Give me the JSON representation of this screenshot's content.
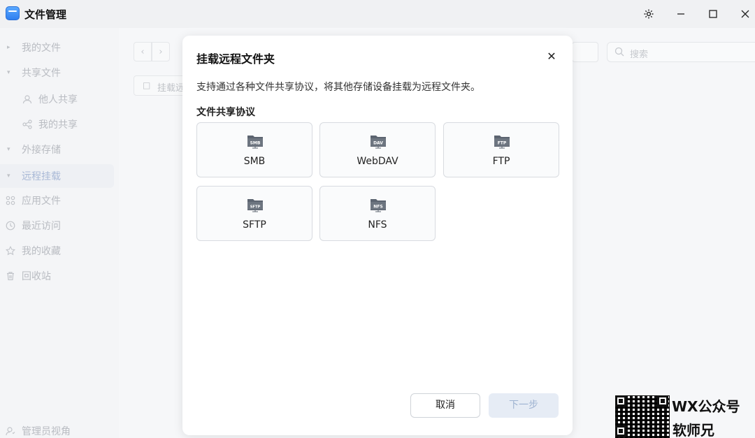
{
  "app": {
    "title": "文件管理"
  },
  "window": {
    "settings_icon": "gear-icon",
    "minimize_icon": "minimize-icon",
    "maximize_icon": "maximize-icon",
    "close_icon": "close-icon"
  },
  "sidebar": {
    "items": [
      {
        "label": "我的文件",
        "icon": "chevron-right-icon"
      },
      {
        "label": "共享文件",
        "icon": "chevron-down-icon"
      },
      {
        "label": "他人共享",
        "icon": "user-icon"
      },
      {
        "label": "我的共享",
        "icon": "share-icon"
      },
      {
        "label": "外接存储",
        "icon": "chevron-down-icon"
      },
      {
        "label": "远程挂载",
        "icon": "chevron-down-icon"
      },
      {
        "label": "应用文件",
        "icon": "apps-icon"
      },
      {
        "label": "最近访问",
        "icon": "clock-icon"
      },
      {
        "label": "我的收藏",
        "icon": "star-icon"
      },
      {
        "label": "回收站",
        "icon": "trash-icon"
      },
      {
        "label": "管理员视角",
        "icon": "admin-user-icon"
      }
    ]
  },
  "main": {
    "search_placeholder": "搜索",
    "mount_button_label": "挂载远"
  },
  "modal": {
    "title": "挂载远程文件夹",
    "description": "支持通过各种文件共享协议，将其他存储设备挂载为远程文件夹。",
    "section_title": "文件共享协议",
    "protocols": [
      {
        "label": "SMB",
        "badge": "SMB"
      },
      {
        "label": "WebDAV",
        "badge": "DAV"
      },
      {
        "label": "FTP",
        "badge": "FTP"
      },
      {
        "label": "SFTP",
        "badge": "SFTP"
      },
      {
        "label": "NFS",
        "badge": "NFS"
      }
    ],
    "cancel_label": "取消",
    "next_label": "下一步"
  },
  "watermark": {
    "line1": "WX公众号",
    "line2": "软师兄"
  }
}
